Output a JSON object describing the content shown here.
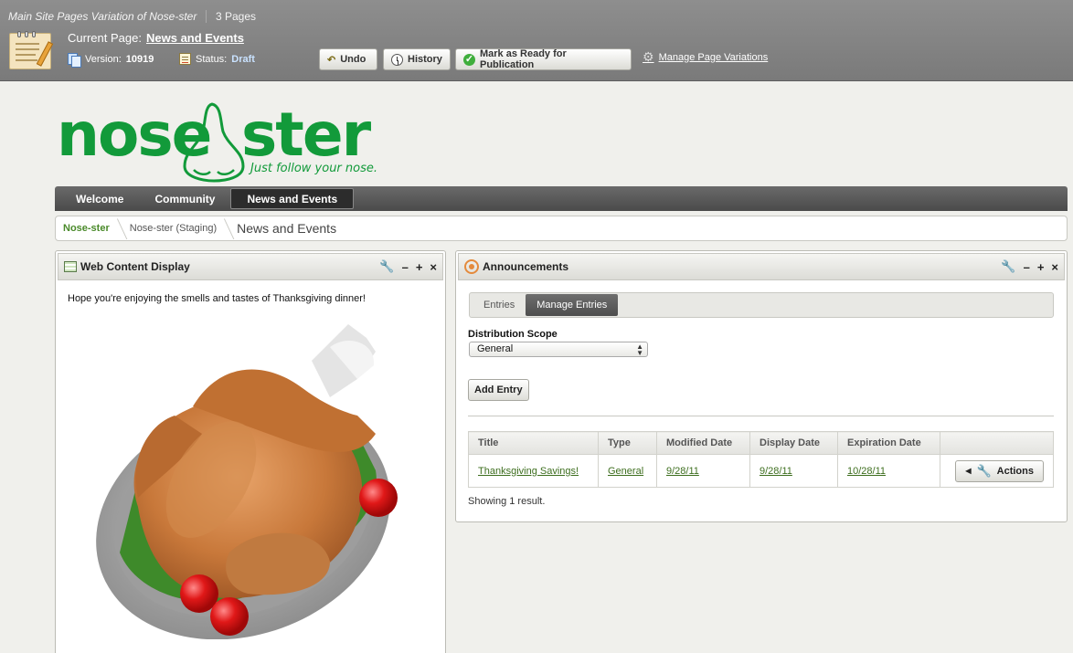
{
  "staging": {
    "variation_title": "Main Site Pages Variation of Nose-ster",
    "pages_count": "3 Pages",
    "current_page_label": "Current Page:",
    "current_page_link": "News and Events",
    "version_label": "Version:",
    "version_value": "10919",
    "status_label": "Status:",
    "status_value": "Draft",
    "buttons": {
      "undo": "Undo",
      "history": "History",
      "mark_ready": "Mark as Ready for Publication"
    },
    "manage_variations": "Manage Page Variations"
  },
  "logo": {
    "text_left": "nose",
    "text_right": "ster",
    "tagline": "Just follow your nose.",
    "brand_color": "#129a3a"
  },
  "nav": {
    "items": [
      {
        "label": "Welcome"
      },
      {
        "label": "Community"
      },
      {
        "label": "News and Events"
      }
    ],
    "active_index": 2
  },
  "breadcrumb": {
    "items": [
      "Nose-ster",
      "Nose-ster (Staging)",
      "News and Events"
    ]
  },
  "web_content": {
    "title": "Web Content Display",
    "text": "Hope you're enjoying the smells and tastes of Thanksgiving dinner!",
    "image": "roast-turkey-illustration"
  },
  "announcements": {
    "title": "Announcements",
    "tabs": [
      "Entries",
      "Manage Entries"
    ],
    "active_tab": 1,
    "distribution_scope_label": "Distribution Scope",
    "distribution_scope_value": "General",
    "add_entry": "Add Entry",
    "columns": [
      "Title",
      "Type",
      "Modified Date",
      "Display Date",
      "Expiration Date",
      ""
    ],
    "rows": [
      {
        "title": "Thanksgiving Savings!",
        "type": "General",
        "modified": "9/28/11",
        "display": "9/28/11",
        "expiration": "10/28/11",
        "actions": "Actions"
      }
    ],
    "result_count": "Showing 1 result."
  },
  "portlet_tools": {
    "configure": "wrench-icon",
    "minimize": "–",
    "maximize": "+",
    "close": "×"
  },
  "colors": {
    "staging_bar": "#858585",
    "link_green": "#3d6e1e",
    "page_bg": "#f0f0ec"
  }
}
